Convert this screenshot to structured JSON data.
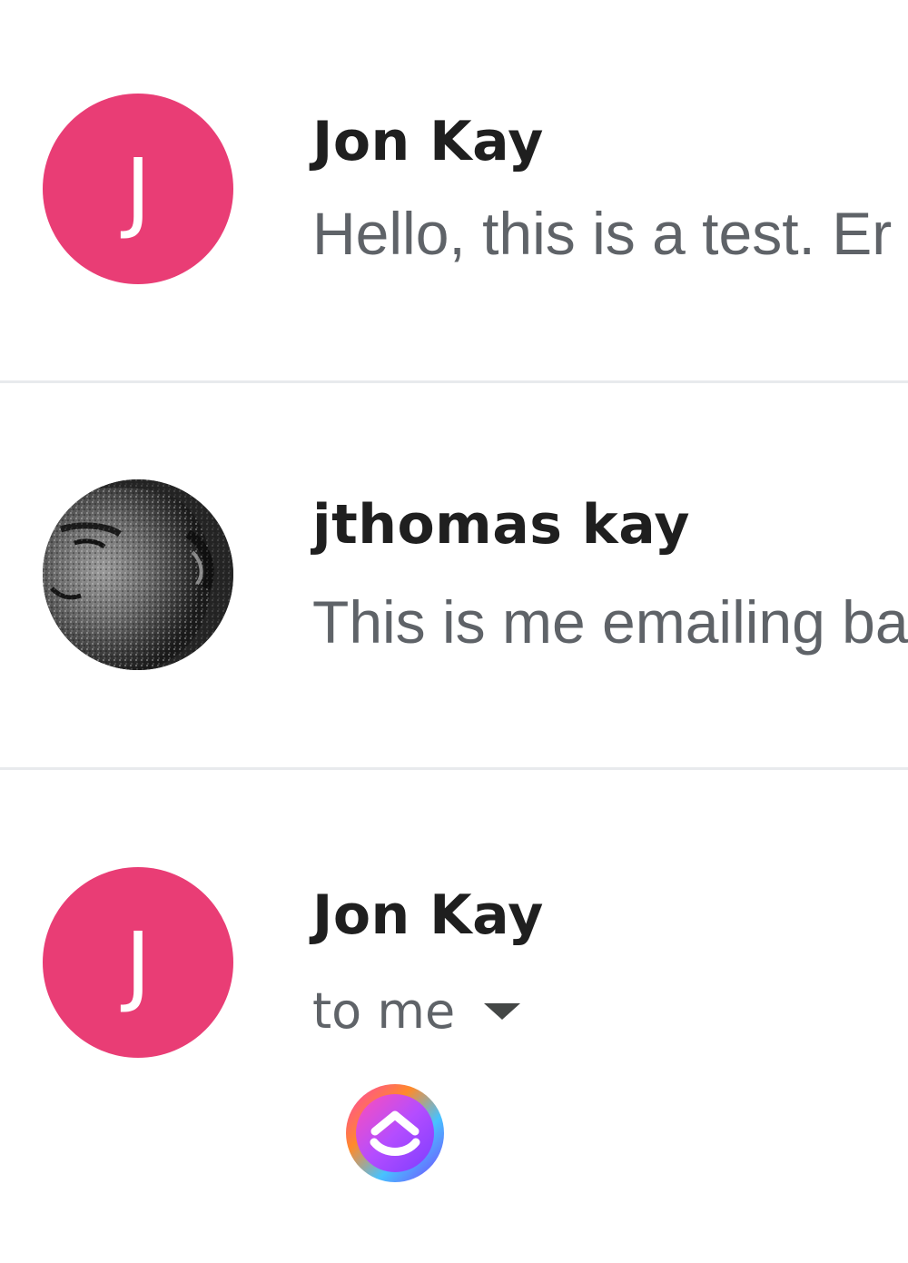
{
  "messages": [
    {
      "sender": "Jon Kay",
      "avatar_letter": "J",
      "avatar_color": "#e93d75",
      "snippet": "Hello, this is a test. Er"
    },
    {
      "sender": "jthomas kay",
      "avatar_type": "photo",
      "snippet": "This is me emailing ba"
    },
    {
      "sender": "Jon Kay",
      "avatar_letter": "J",
      "avatar_color": "#e93d75",
      "recipient_label": "to me",
      "recipient_caret_icon": "caret-down-icon",
      "extension_icon": "clickup-icon"
    }
  ],
  "colors": {
    "sender_text": "#1f1f1f",
    "secondary_text": "#5f6368",
    "divider": "#e8eaed"
  }
}
